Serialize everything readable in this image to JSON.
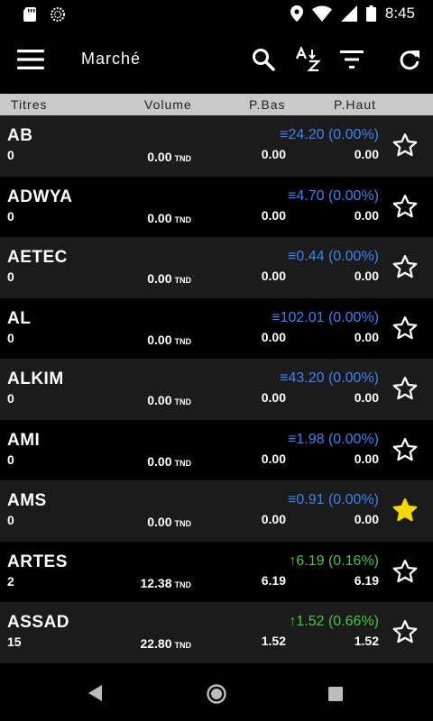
{
  "status": {
    "time": "8:45"
  },
  "toolbar": {
    "title": "Marché"
  },
  "columns": {
    "titres": "Titres",
    "volume": "Volume",
    "pbas": "P.Bas",
    "phaut": "P.Haut"
  },
  "colors": {
    "accent_blue": "#3b82f6",
    "accent_green": "#43c943",
    "star_favorite": "#f5d800"
  },
  "rows": [
    {
      "symbol": "AB",
      "qty": "0",
      "volume": "0.00",
      "unit": "TND",
      "price": "≡24.20 (0.00%)",
      "trend": "flat",
      "low": "0.00",
      "high": "0.00",
      "favorite": false
    },
    {
      "symbol": "ADWYA",
      "qty": "0",
      "volume": "0.00",
      "unit": "TND",
      "price": "≡4.70 (0.00%)",
      "trend": "flat",
      "low": "0.00",
      "high": "0.00",
      "favorite": false
    },
    {
      "symbol": "AETEC",
      "qty": "0",
      "volume": "0.00",
      "unit": "TND",
      "price": "≡0.44 (0.00%)",
      "trend": "flat",
      "low": "0.00",
      "high": "0.00",
      "favorite": false
    },
    {
      "symbol": "AL",
      "qty": "0",
      "volume": "0.00",
      "unit": "TND",
      "price": "≡102.01 (0.00%)",
      "trend": "flat",
      "low": "0.00",
      "high": "0.00",
      "favorite": false
    },
    {
      "symbol": "ALKIM",
      "qty": "0",
      "volume": "0.00",
      "unit": "TND",
      "price": "≡43.20 (0.00%)",
      "trend": "flat",
      "low": "0.00",
      "high": "0.00",
      "favorite": false
    },
    {
      "symbol": "AMI",
      "qty": "0",
      "volume": "0.00",
      "unit": "TND",
      "price": "≡1.98 (0.00%)",
      "trend": "flat",
      "low": "0.00",
      "high": "0.00",
      "favorite": false
    },
    {
      "symbol": "AMS",
      "qty": "0",
      "volume": "0.00",
      "unit": "TND",
      "price": "≡0.91 (0.00%)",
      "trend": "flat",
      "low": "0.00",
      "high": "0.00",
      "favorite": true
    },
    {
      "symbol": "ARTES",
      "qty": "2",
      "volume": "12.38",
      "unit": "TND",
      "price": "↑6.19 (0.16%)",
      "trend": "up",
      "low": "6.19",
      "high": "6.19",
      "favorite": false
    },
    {
      "symbol": "ASSAD",
      "qty": "15",
      "volume": "22.80",
      "unit": "TND",
      "price": "↑1.52 (0.66%)",
      "trend": "up",
      "low": "1.52",
      "high": "1.52",
      "favorite": false
    }
  ]
}
